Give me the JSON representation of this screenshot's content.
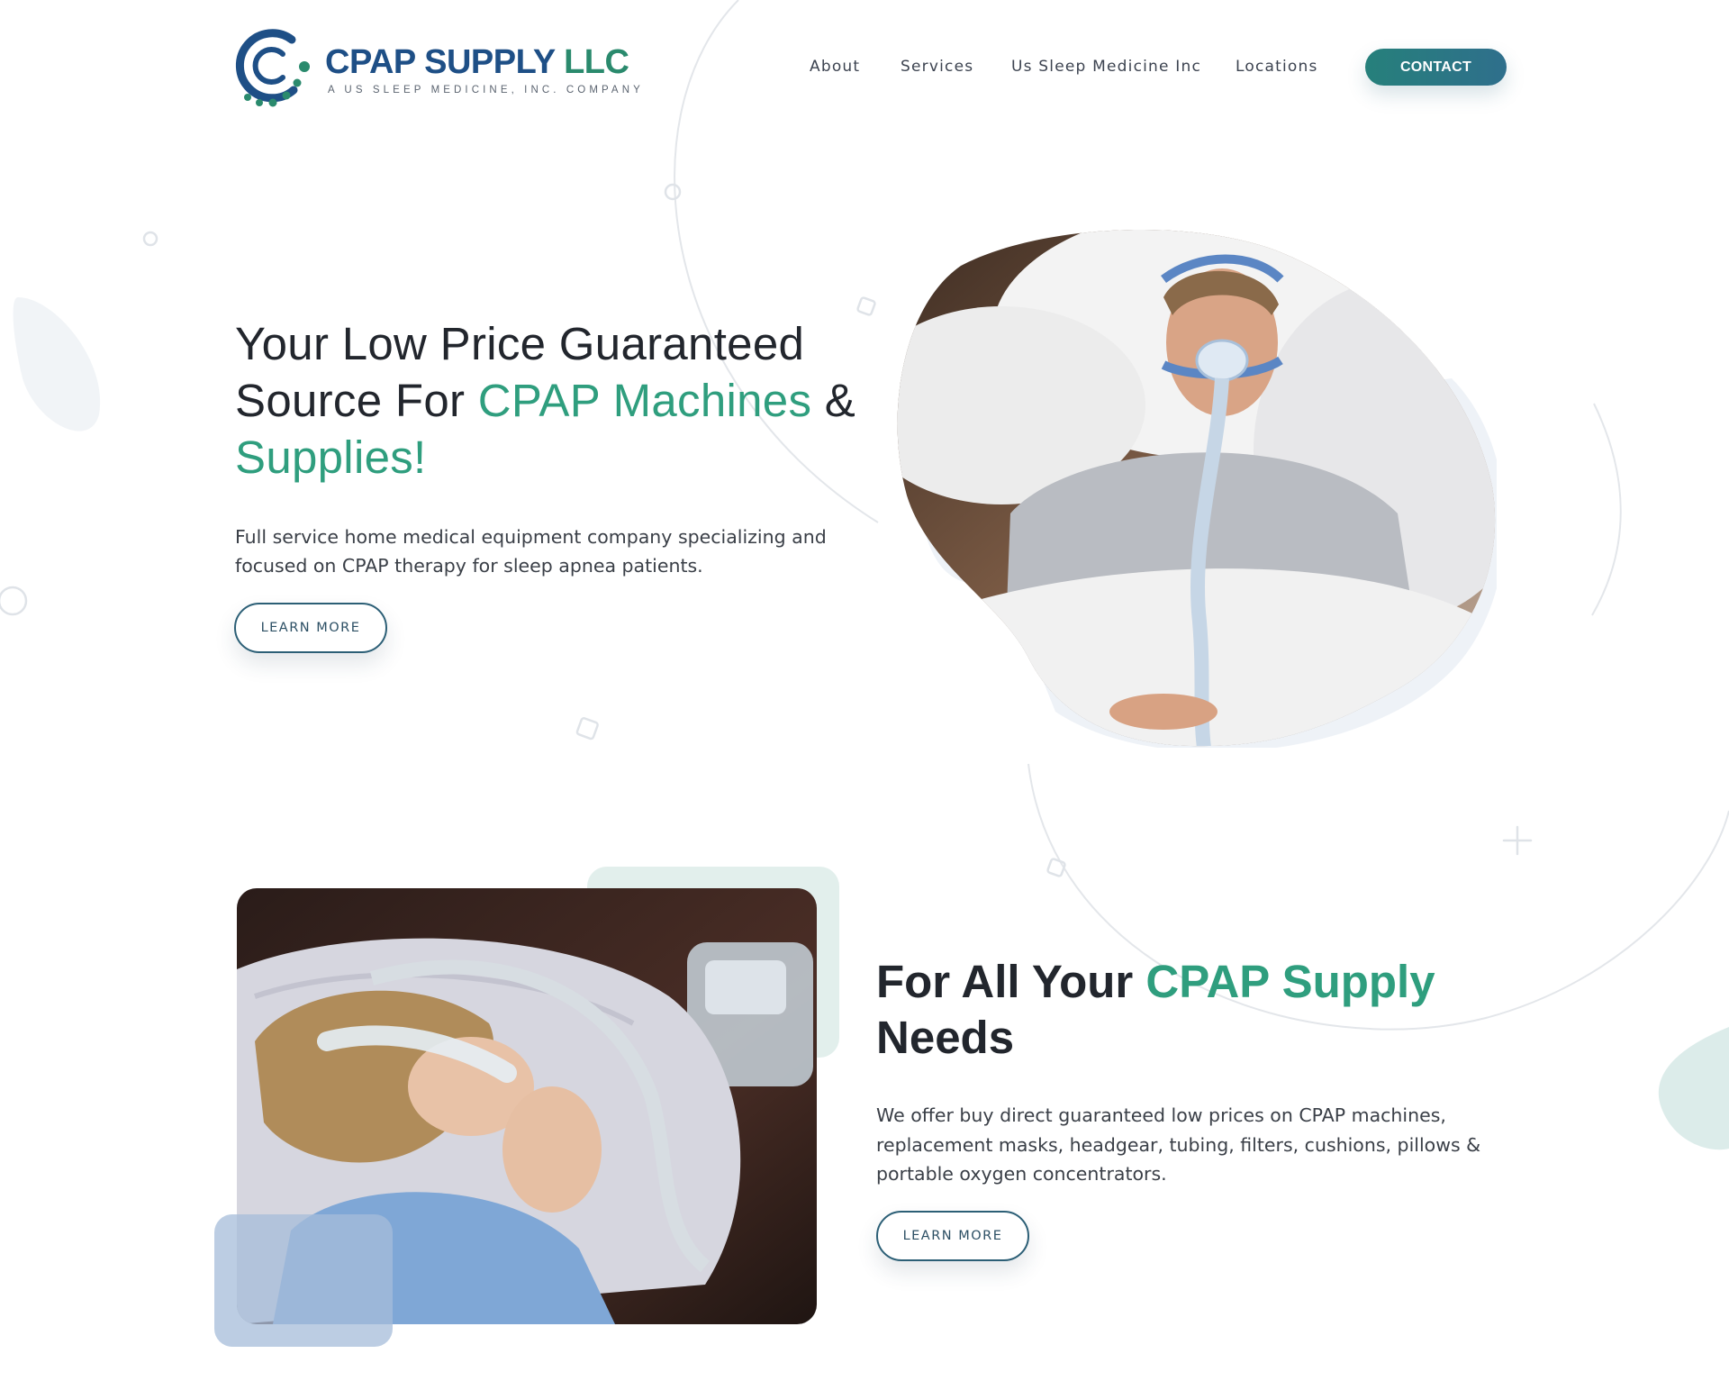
{
  "brand": {
    "name_part1": "CPAP SUPPLY",
    "name_part2": "LLC",
    "tagline": "A US SLEEP MEDICINE, INC. COMPANY",
    "primary_color": "#1e4f86",
    "accent_color": "#2a8a6d"
  },
  "nav": {
    "items": [
      {
        "label": "About"
      },
      {
        "label": "Services"
      },
      {
        "label": "Us Sleep Medicine Inc"
      },
      {
        "label": "Locations"
      }
    ],
    "contact_label": "CONTACT"
  },
  "hero": {
    "heading_line1": "Your Low Price Guaranteed",
    "heading_line2_a": "Source For ",
    "heading_line2_accent": "CPAP Machines",
    "heading_line2_b": " &",
    "heading_line3_accent": "Supplies!",
    "description": "Full service home medical equipment company specializing and focused on CPAP therapy for sleep apnea patients.",
    "button_label": "LEARN MORE",
    "image_icon": "man-sleeping-with-cpap-mask-photo"
  },
  "supply_section": {
    "heading_a": "For All Your ",
    "heading_accent": "CPAP Supply",
    "heading_b": "Needs",
    "description": "We offer buy direct guaranteed low prices on CPAP machines, replacement masks, headgear, tubing, filters, cushions, pillows & portable oxygen concentrators.",
    "button_label": "LEARN MORE",
    "image_icon": "woman-sleeping-with-nasal-cpap-photo"
  },
  "colors": {
    "heading_accent": "#2f9e7e",
    "contact_button": "#26807b",
    "button_border": "#2c5f76"
  }
}
